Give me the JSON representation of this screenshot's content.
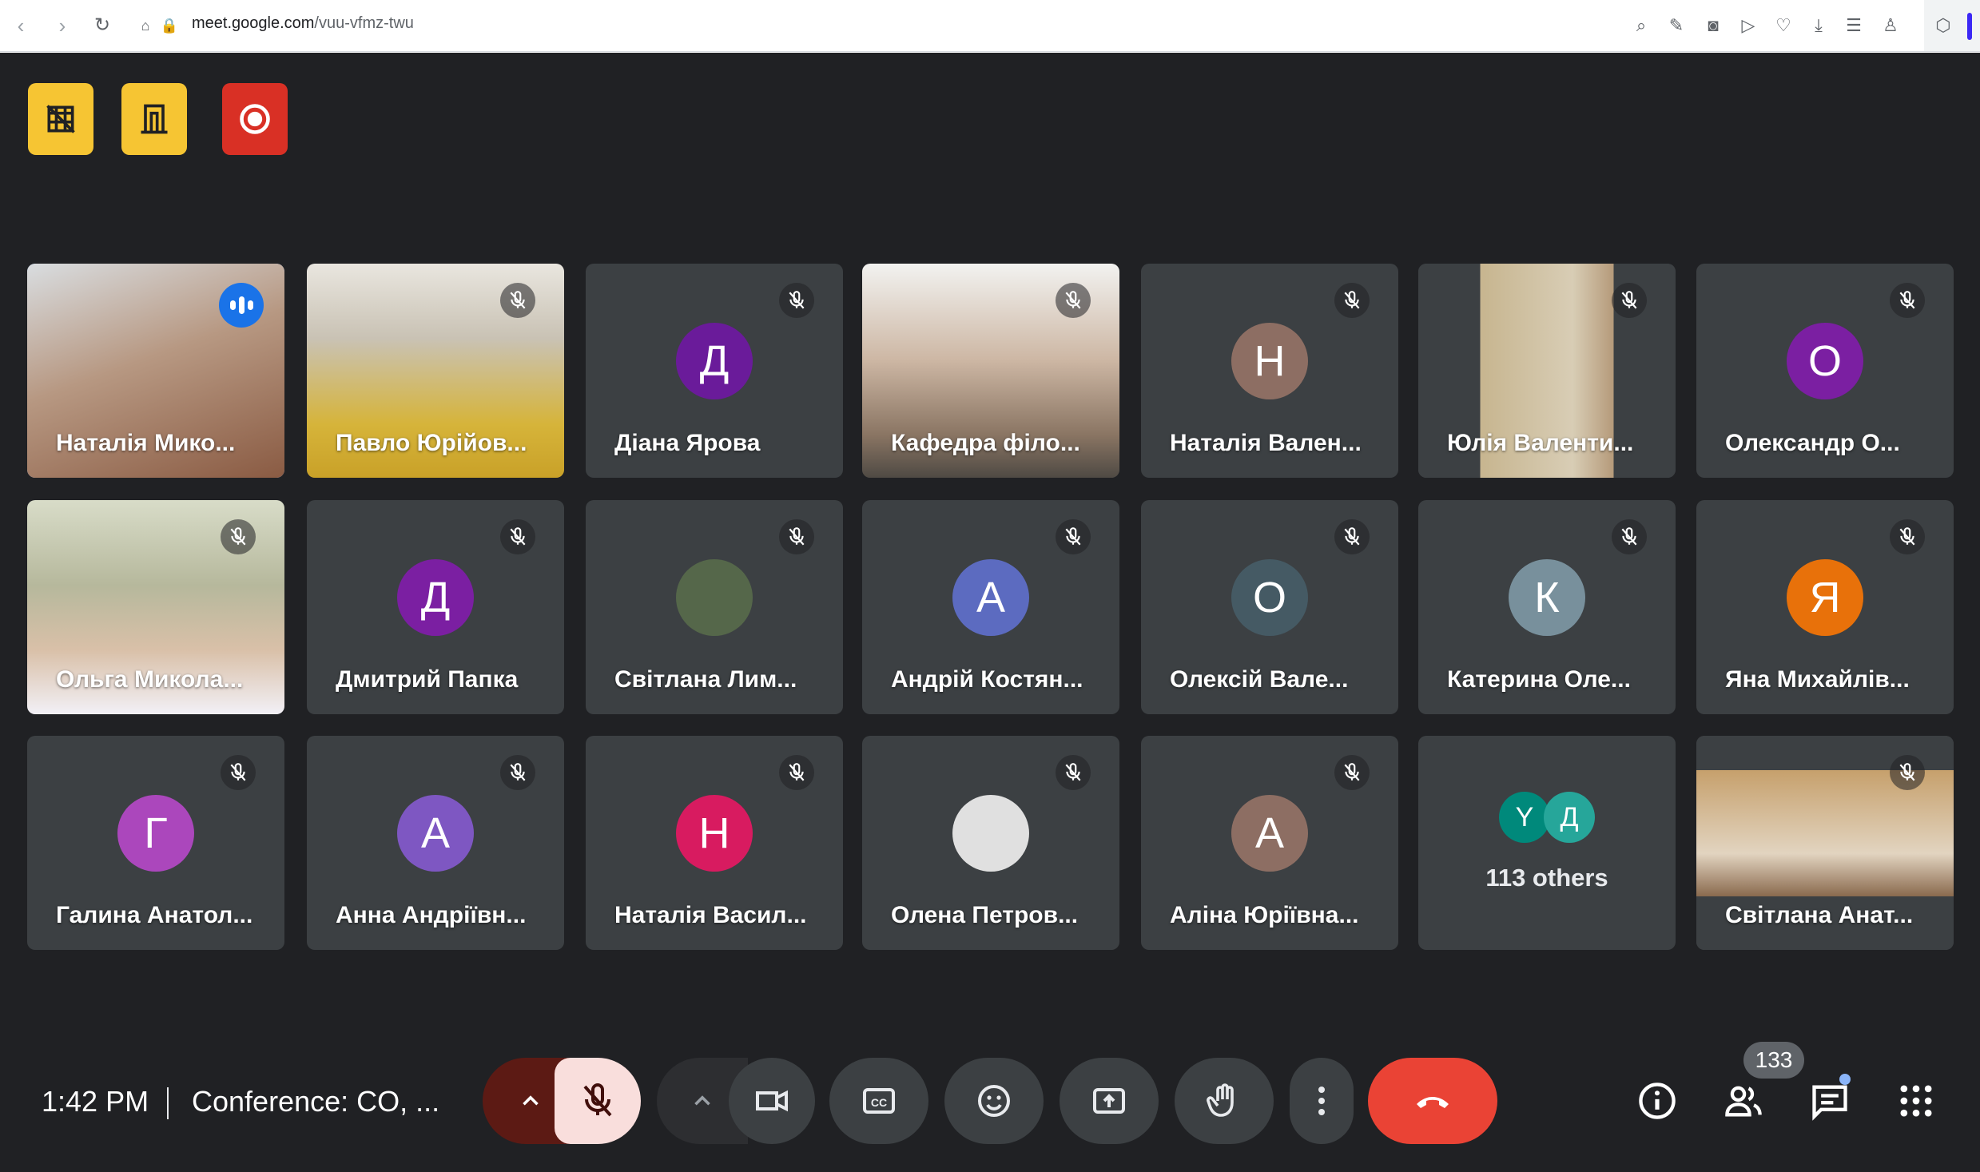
{
  "browser": {
    "url_host": "meet.google.com",
    "url_path": "/vuu-vfmz-twu"
  },
  "participants": [
    {
      "name": "Наталія Мико...",
      "initial": "",
      "avatar_color": "",
      "muted": false,
      "speaking": true,
      "video": true
    },
    {
      "name": "Павло Юрійов...",
      "initial": "",
      "avatar_color": "",
      "muted": true,
      "speaking": false,
      "video": true
    },
    {
      "name": "Діана Ярова",
      "initial": "Д",
      "avatar_color": "#6a1b9a",
      "muted": true,
      "speaking": false,
      "video": false
    },
    {
      "name": "Кафедра філо...",
      "initial": "",
      "avatar_color": "",
      "muted": true,
      "speaking": false,
      "video": true
    },
    {
      "name": "Наталія Вален...",
      "initial": "Н",
      "avatar_color": "#8d6e63",
      "muted": true,
      "speaking": false,
      "video": false
    },
    {
      "name": "Юлія Валенти...",
      "initial": "",
      "avatar_color": "",
      "muted": true,
      "speaking": false,
      "video": true
    },
    {
      "name": "Олександр О...",
      "initial": "О",
      "avatar_color": "#7b1fa2",
      "muted": true,
      "speaking": false,
      "video": false
    },
    {
      "name": "Ольга Микола...",
      "initial": "",
      "avatar_color": "",
      "muted": true,
      "speaking": false,
      "video": true
    },
    {
      "name": "Дмитрий Папка",
      "initial": "Д",
      "avatar_color": "#7b1fa2",
      "muted": true,
      "speaking": false,
      "video": false
    },
    {
      "name": "Світлана Лим...",
      "initial": "",
      "avatar_color": "#55674a",
      "muted": true,
      "speaking": false,
      "video": false
    },
    {
      "name": "Андрій Костян...",
      "initial": "А",
      "avatar_color": "#5c6bc0",
      "muted": true,
      "speaking": false,
      "video": false
    },
    {
      "name": "Олексій Вале...",
      "initial": "О",
      "avatar_color": "#455a64",
      "muted": true,
      "speaking": false,
      "video": false
    },
    {
      "name": "Катерина Оле...",
      "initial": "К",
      "avatar_color": "#78909c",
      "muted": true,
      "speaking": false,
      "video": false
    },
    {
      "name": "Яна Михайлів...",
      "initial": "Я",
      "avatar_color": "#e8710a",
      "muted": true,
      "speaking": false,
      "video": false
    },
    {
      "name": "Галина Анатол...",
      "initial": "Г",
      "avatar_color": "#ab47bc",
      "muted": true,
      "speaking": false,
      "video": false
    },
    {
      "name": "Анна Андріївн...",
      "initial": "А",
      "avatar_color": "#7e57c2",
      "muted": true,
      "speaking": false,
      "video": false
    },
    {
      "name": "Наталія Васил...",
      "initial": "Н",
      "avatar_color": "#d81b60",
      "muted": true,
      "speaking": false,
      "video": false
    },
    {
      "name": "Олена Петров...",
      "initial": "",
      "avatar_color": "#e0e0e0",
      "muted": true,
      "speaking": false,
      "video": false
    },
    {
      "name": "Аліна Юріївна...",
      "initial": "А",
      "avatar_color": "#8d6e63",
      "muted": true,
      "speaking": false,
      "video": false
    },
    {
      "name": "",
      "initial": "",
      "avatar_color": "",
      "muted": false,
      "speaking": false,
      "video": false
    },
    {
      "name": "Світлана Анат...",
      "initial": "",
      "avatar_color": "",
      "muted": true,
      "speaking": false,
      "video": true
    }
  ],
  "others_tile": {
    "text": "113 others",
    "avatars": [
      {
        "initial": "Y",
        "color": "#00897b"
      },
      {
        "initial": "Д",
        "color": "#26a69a"
      }
    ]
  },
  "footer": {
    "time": "1:42 PM",
    "meeting_title": "Conference: CO, ...",
    "participant_count": "133"
  },
  "icons": {
    "ext_buttons": [
      "grid-off-icon",
      "door-icon",
      "record-icon"
    ],
    "controls": [
      "chevron-up-icon",
      "mic-off-icon",
      "camera-icon",
      "captions-icon",
      "emoji-icon",
      "present-icon",
      "raise-hand-icon",
      "more-icon",
      "end-call-icon"
    ],
    "right": [
      "info-icon",
      "people-icon",
      "chat-icon",
      "activities-icon"
    ]
  },
  "colors": {
    "background": "#202124",
    "tile": "#3c4043",
    "end_call": "#ea4335",
    "mic_off_bg": "#f9dedc",
    "mic_menu_bg": "#5c1a14",
    "speaking_ring": "#8ab4f8",
    "ext_yellow": "#f6c533",
    "ext_red": "#d93025"
  }
}
